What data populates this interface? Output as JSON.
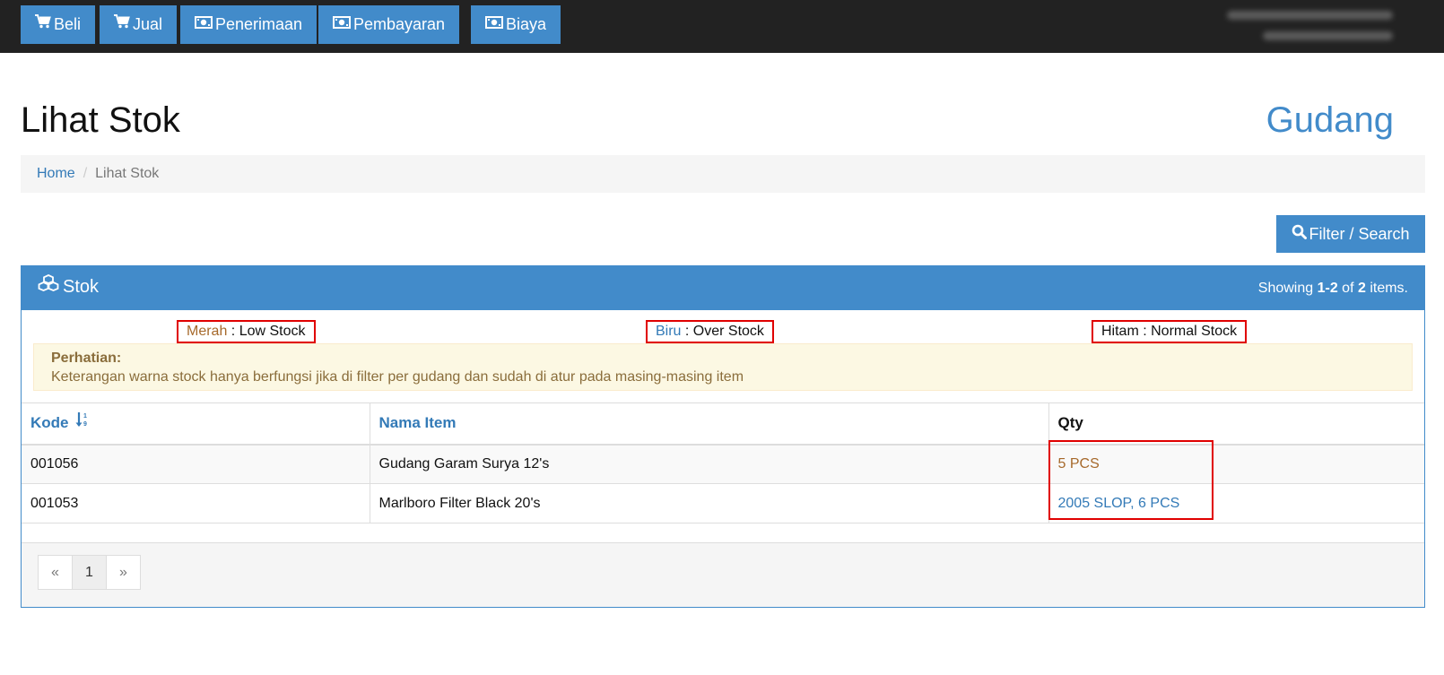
{
  "nav": {
    "buttons": [
      {
        "label": "Beli",
        "icon": "cart-icon"
      },
      {
        "label": "Jual",
        "icon": "cart-icon"
      },
      {
        "label": "Penerimaan",
        "icon": "money-icon"
      },
      {
        "label": "Pembayaran",
        "icon": "money-icon"
      },
      {
        "label": "Biaya",
        "icon": "money-icon"
      }
    ]
  },
  "header": {
    "title": "Lihat Stok",
    "location": "Gudang"
  },
  "breadcrumb": {
    "home": "Home",
    "separator": "/",
    "current": "Lihat Stok"
  },
  "filter_button": {
    "label": "Filter / Search",
    "icon": "search-icon"
  },
  "panel": {
    "title": "Stok",
    "icon": "cubes-icon",
    "summary": {
      "prefix": "Showing ",
      "range": "1-2",
      "middle": " of ",
      "total": "2",
      "suffix": " items."
    }
  },
  "legend": {
    "low": {
      "color_name": "Merah",
      "text": " : Low Stock",
      "color": "#a6692b"
    },
    "over": {
      "color_name": "Biru",
      "text": " : Over Stock",
      "color": "#337ab7"
    },
    "normal": {
      "color_name": "Hitam",
      "text": " : Normal Stock",
      "color": "#111111"
    }
  },
  "alert": {
    "title": "Perhatian:",
    "message": "Keterangan warna stock hanya berfungsi jika di filter per gudang dan sudah di atur pada masing-masing item"
  },
  "table": {
    "columns": {
      "kode": "Kode",
      "nama": "Nama Item",
      "qty": "Qty"
    },
    "sort_icon": "sort-numeric-asc-icon",
    "rows": [
      {
        "kode": "001056",
        "nama": "Gudang Garam Surya 12's",
        "qty": "5 PCS",
        "status": "low"
      },
      {
        "kode": "001053",
        "nama": "Marlboro Filter Black 20's",
        "qty": "2005 SLOP, 6 PCS",
        "status": "over"
      }
    ]
  },
  "pagination": {
    "prev": "«",
    "current": "1",
    "next": "»"
  }
}
